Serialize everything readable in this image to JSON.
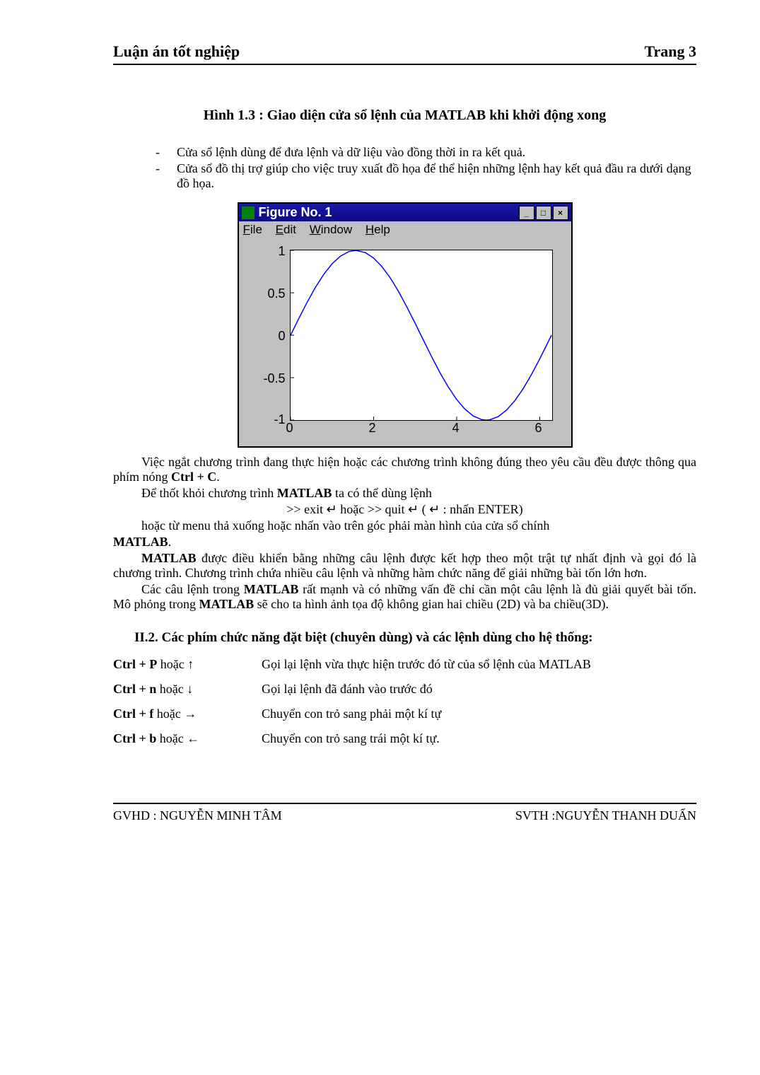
{
  "header": {
    "left": "Luận án tốt nghiệp",
    "right": "Trang 3"
  },
  "fig_caption": "Hình 1.3 : Giao diện cửa sổ lệnh của MATLAB khi khởi động xong",
  "bullets": [
    "Cửa sổ lệnh dùng để đưa lệnh và dữ liệu vào đồng thời in ra kết quả.",
    "Cửa sổ đồ thị trợ giúp cho việc truy xuất đồ họa để thể hiện những lệnh hay kết quả đầu ra dưới dạng đồ họa."
  ],
  "figure_window": {
    "title": "Figure No. 1",
    "menus": [
      "File",
      "Edit",
      "Window",
      "Help"
    ]
  },
  "chart_data": {
    "type": "line",
    "title": "",
    "xlabel": "",
    "ylabel": "",
    "xlim": [
      0,
      6.3
    ],
    "ylim": [
      -1,
      1
    ],
    "xticks": [
      0,
      2,
      4,
      6
    ],
    "yticks": [
      -1,
      -0.5,
      0,
      0.5,
      1
    ],
    "series": [
      {
        "name": "sin(x)",
        "color": "#0000ff",
        "x": [
          0,
          0.2,
          0.4,
          0.6,
          0.8,
          1.0,
          1.2,
          1.4,
          1.5708,
          1.8,
          2.0,
          2.2,
          2.4,
          2.6,
          2.8,
          3.0,
          3.1416,
          3.4,
          3.6,
          3.8,
          4.0,
          4.2,
          4.4,
          4.6,
          4.7124,
          4.8,
          5.0,
          5.2,
          5.4,
          5.6,
          5.8,
          6.0,
          6.2,
          6.2832
        ],
        "y": [
          0,
          0.1987,
          0.3894,
          0.5646,
          0.7174,
          0.8415,
          0.932,
          0.9854,
          1.0,
          0.9738,
          0.9093,
          0.8085,
          0.6755,
          0.5155,
          0.335,
          0.1411,
          0.0,
          -0.2555,
          -0.4425,
          -0.6119,
          -0.7568,
          -0.8716,
          -0.9516,
          -0.9937,
          -1.0,
          -0.9962,
          -0.9589,
          -0.8835,
          -0.7728,
          -0.6313,
          -0.4646,
          -0.2794,
          -0.0831,
          0.0
        ]
      }
    ]
  },
  "body": {
    "p1a": "Việc ngắt chương trình đang thực hiện hoặc các chương trình không đúng theo yêu cầu đều được thông qua phím nóng ",
    "p1b": "Ctrl + C",
    "p1c": ".",
    "p2a": "Để thốt khỏi chương trình ",
    "p2b": "MATLAB",
    "p2c": " ta có thể dùng lệnh",
    "cmd": ">> exit ↵ hoặc  >> quit ↵ ( ↵ : nhấn ENTER)",
    "p3a": "hoặc từ menu thả xuống hoặc nhấn vào trên góc phải màn hình của cửa sổ chính ",
    "p3b": "MATLAB",
    "p3c": ".",
    "p4a": "MATLAB",
    "p4b": " được điều khiển bằng những câu lệnh được kết hợp theo một trật tự nhất định và gọi đó là chương trình. Chương trình chứa nhiều câu lệnh và những hàm chức năng để giải những bài tốn lớn hơn.",
    "p5a": "Các câu lệnh trong ",
    "p5b": "MATLAB",
    "p5c": " rất mạnh và có những vấn đề chỉ cần một câu lệnh là đủ giải quyết bài tốn. Mô phỏng trong ",
    "p5d": "MATLAB",
    "p5e": " sẽ cho ta hình ảnh tọa độ không gian hai chiều (2D) và ba chiều(3D)."
  },
  "section_title": "II.2. Các phím chức năng đặt biệt (chuyên dùng) và các lệnh dùng cho hệ thống:",
  "shortcut_word_or": " hoặc ",
  "shortcuts": [
    {
      "key": "Ctrl + P",
      "arrow": "↑",
      "desc": "Gọi lại lệnh vừa thực hiện trước đó từ của sổ lệnh của MATLAB"
    },
    {
      "key": "Ctrl + n",
      "arrow": "↓",
      "desc": "Gọi lại lệnh đã đánh vào trước đó"
    },
    {
      "key": "Ctrl + f",
      "arrow": "→",
      "desc": "Chuyển con trỏ sang phải một kí tự"
    },
    {
      "key": "Ctrl + b",
      "arrow": "←",
      "desc": "Chuyển con trỏ sang trái một kí tự."
    }
  ],
  "footer": {
    "left": "GVHD : NGUYỄN MINH TÂM",
    "right": "SVTH :NGUYỄN THANH DUẨN"
  }
}
